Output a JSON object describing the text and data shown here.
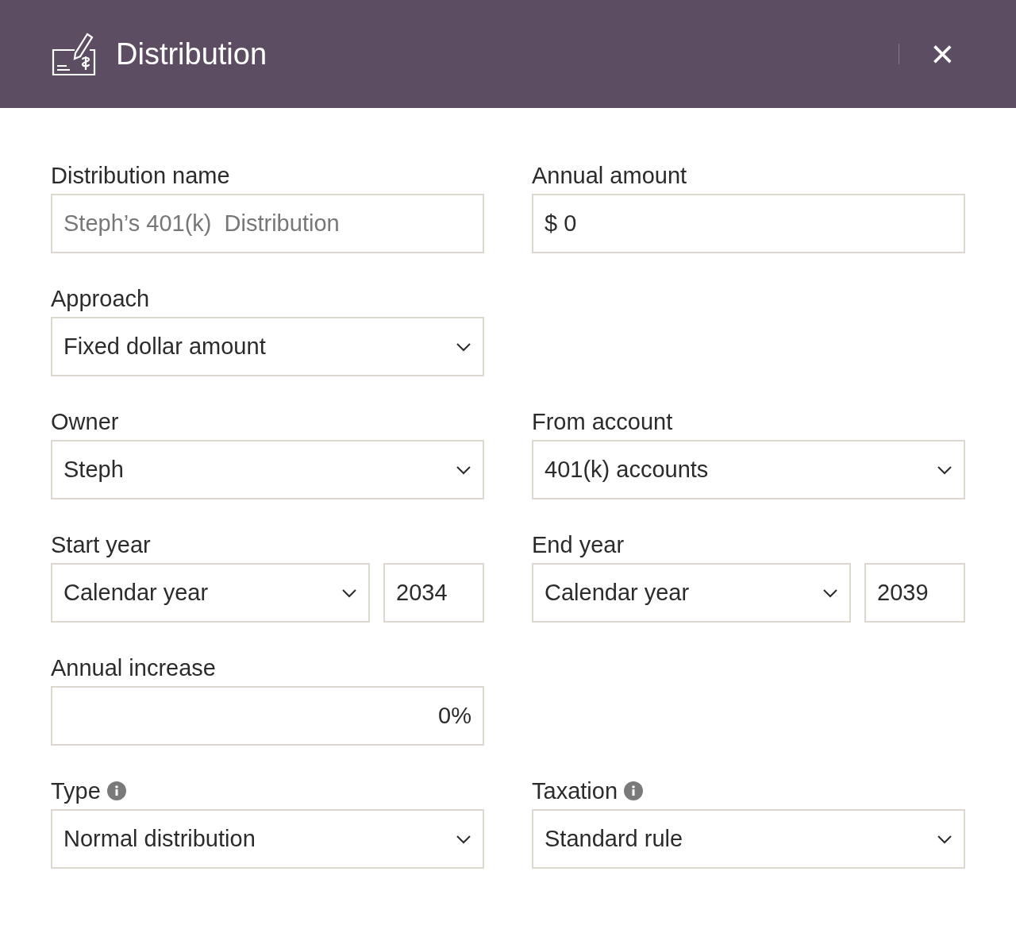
{
  "header": {
    "title": "Distribution",
    "close": "×"
  },
  "rows": [
    [
      {
        "kind": "text",
        "label": "Distribution name",
        "placeholder": "Steph’s 401(k)  Distribution"
      },
      {
        "kind": "text",
        "label": "Annual amount",
        "value": "$ 0"
      }
    ],
    [
      {
        "kind": "select",
        "label": "Approach",
        "value": "Fixed dollar amount"
      }
    ],
    [
      {
        "kind": "select",
        "label": "Owner",
        "value": "Steph"
      },
      {
        "kind": "select",
        "label": "From account",
        "value": "401(k) accounts"
      }
    ],
    [
      {
        "kind": "year",
        "label": "Start year",
        "value": "Calendar year",
        "year": "2034"
      },
      {
        "kind": "year",
        "label": "End year",
        "value": "Calendar year",
        "year": "2039"
      }
    ],
    [
      {
        "kind": "percent",
        "label": "Annual increase",
        "value": "0%"
      }
    ],
    [
      {
        "kind": "select",
        "label": "Type",
        "info": true,
        "value": "Normal distribution"
      },
      {
        "kind": "select",
        "label": "Taxation",
        "info": true,
        "value": "Standard rule"
      }
    ]
  ]
}
